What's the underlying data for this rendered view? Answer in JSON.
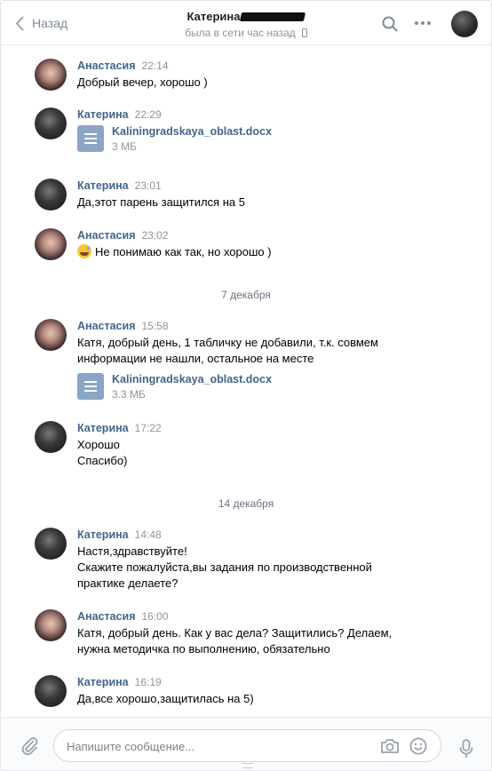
{
  "header": {
    "back_label": "Назад",
    "peer_name": "Катерина",
    "peer_status": "была в сети час назад"
  },
  "messages": [
    {
      "author": "Анастасия",
      "time": "22:14",
      "lines": [
        "Добрый вечер, хорошо )"
      ]
    },
    {
      "author": "Катерина",
      "time": "22:29",
      "doc": {
        "name": "Kaliningradskaya_oblast.docx",
        "size": "3 МБ"
      }
    },
    {
      "author": "Катерина",
      "time": "23:01",
      "lines": [
        "Да,этот парень защитился на 5"
      ]
    },
    {
      "author": "Анастасия",
      "time": "23:02",
      "lines": [
        "Не понимаю как так, но хорошо )"
      ]
    },
    {
      "author": "Анастасия",
      "time": "15:58",
      "lines": [
        "Катя, добрый день, 1 табличку не добавили, т.к. совмем",
        "информации не нашли, остальное на месте"
      ],
      "doc": {
        "name": "Kaliningradskaya_oblast.docx",
        "size": "3.3 МБ"
      }
    },
    {
      "author": "Катерина",
      "time": "17:22",
      "lines": [
        "Хорошо",
        "Спасибо)"
      ]
    },
    {
      "author": "Катерина",
      "time": "14:48",
      "lines": [
        "Настя,здравствуйте!",
        "Скажите пожалуйста,вы задания по производственной",
        "практике делаете?"
      ]
    },
    {
      "author": "Анастасия",
      "time": "16:00",
      "lines": [
        "Катя, добрый день. Как у вас дела? Защитились? Делаем,",
        "нужна методичка по выполнению, обязательно"
      ]
    },
    {
      "author": "Катерина",
      "time": "16:19",
      "lines": [
        "Да,все хорошо,защитилась на 5)"
      ]
    }
  ],
  "dividers": [
    "7 декабря",
    "14 декабря"
  ],
  "composer": {
    "placeholder": "Напишите сообщение..."
  },
  "icons": {
    "back": "chevron-left-icon",
    "search": "search-icon",
    "more": "more-dots-icon",
    "attach": "paperclip-icon",
    "camera": "camera-icon",
    "emoji": "smile-icon",
    "voice": "microphone-icon",
    "document": "document-icon",
    "emoji_in_message": "grinning-sweat-emoji"
  },
  "colors": {
    "author_link": "#42648b",
    "meta_gray": "#939393",
    "doc_icon": "#8aa5c6",
    "icon_gray": "#828a99"
  }
}
